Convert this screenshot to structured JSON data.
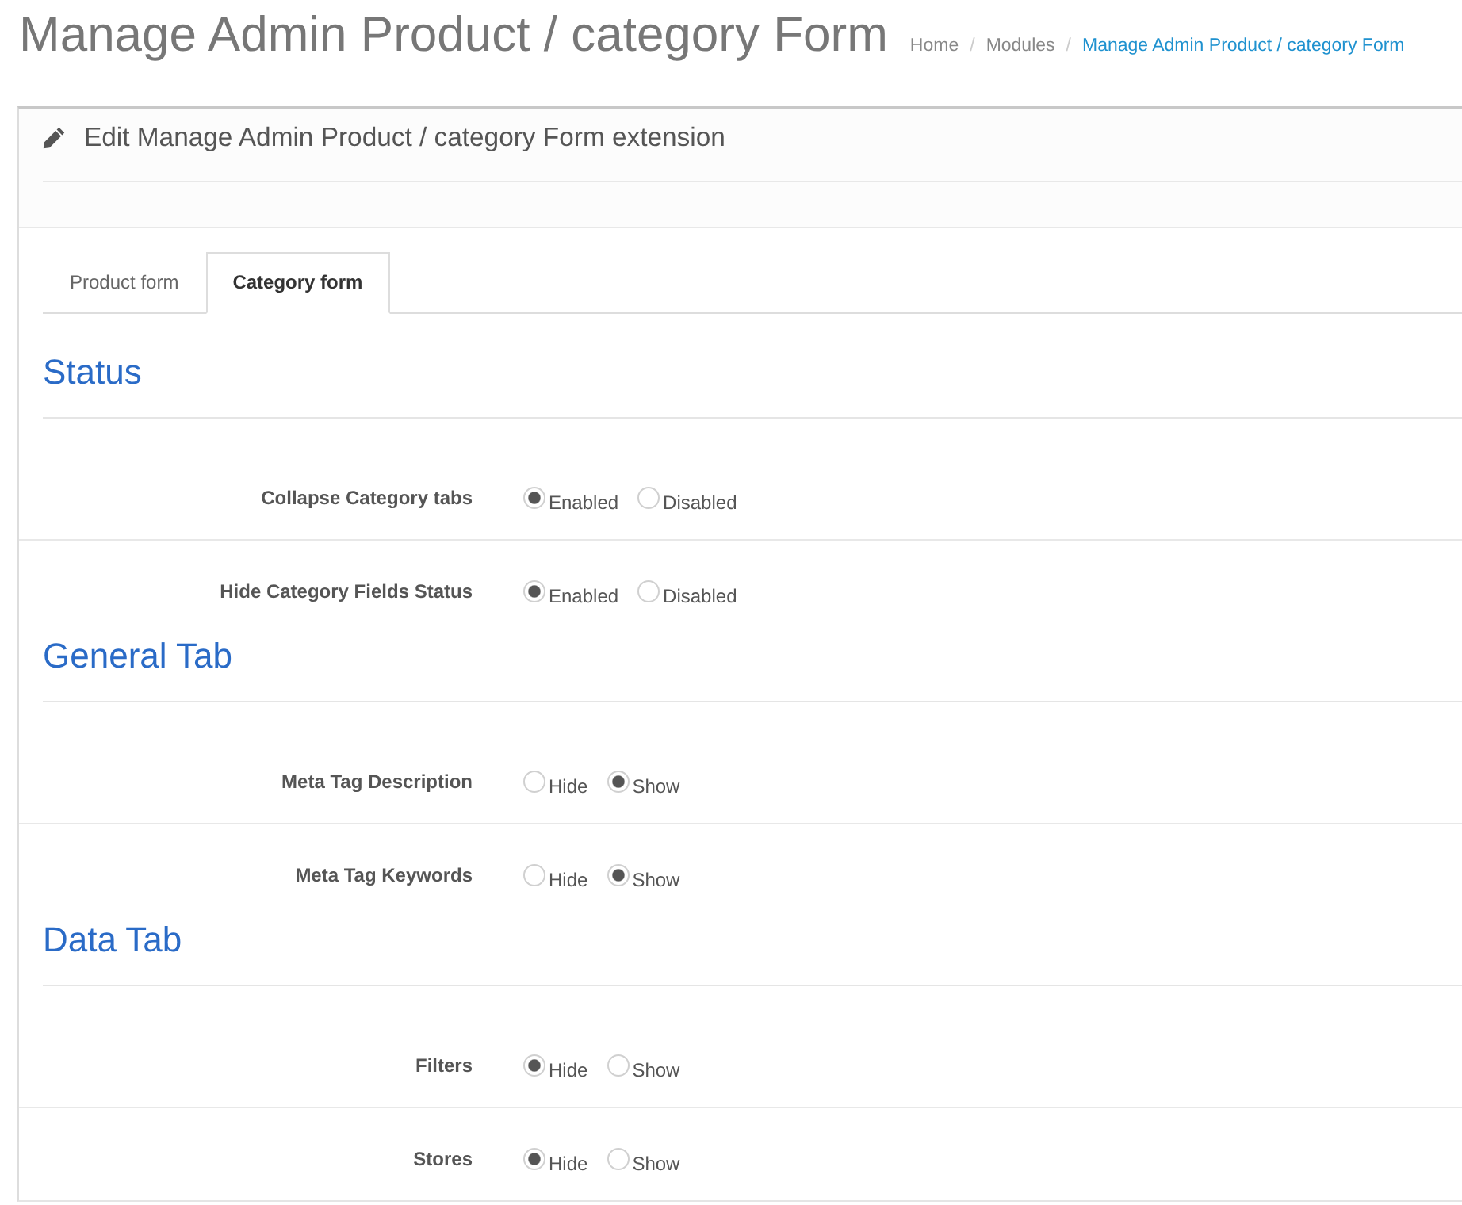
{
  "page": {
    "title": "Manage Admin Product / category Form"
  },
  "breadcrumb": {
    "separator": "/",
    "items": [
      {
        "label": "Home",
        "active": false
      },
      {
        "label": "Modules",
        "active": false
      },
      {
        "label": "Manage Admin Product / category Form",
        "active": true
      }
    ]
  },
  "panel": {
    "title": "Edit Manage Admin Product / category Form extension"
  },
  "tabs": [
    {
      "label": "Product form",
      "selected": false
    },
    {
      "label": "Category form",
      "selected": true
    }
  ],
  "sections": [
    {
      "heading": "Status",
      "fields": [
        {
          "label": "Collapse Category tabs",
          "options": [
            {
              "label": "Enabled",
              "selected": true
            },
            {
              "label": "Disabled",
              "selected": false
            }
          ]
        },
        {
          "label": "Hide Category Fields Status",
          "options": [
            {
              "label": "Enabled",
              "selected": true
            },
            {
              "label": "Disabled",
              "selected": false
            }
          ]
        }
      ]
    },
    {
      "heading": "General Tab",
      "fields": [
        {
          "label": "Meta Tag Description",
          "options": [
            {
              "label": "Hide",
              "selected": false
            },
            {
              "label": "Show",
              "selected": true
            }
          ]
        },
        {
          "label": "Meta Tag Keywords",
          "options": [
            {
              "label": "Hide",
              "selected": false
            },
            {
              "label": "Show",
              "selected": true
            }
          ]
        }
      ]
    },
    {
      "heading": "Data Tab",
      "fields": [
        {
          "label": "Filters",
          "options": [
            {
              "label": "Hide",
              "selected": true
            },
            {
              "label": "Show",
              "selected": false
            }
          ]
        },
        {
          "label": "Stores",
          "options": [
            {
              "label": "Hide",
              "selected": true
            },
            {
              "label": "Show",
              "selected": false
            }
          ]
        }
      ]
    }
  ]
}
